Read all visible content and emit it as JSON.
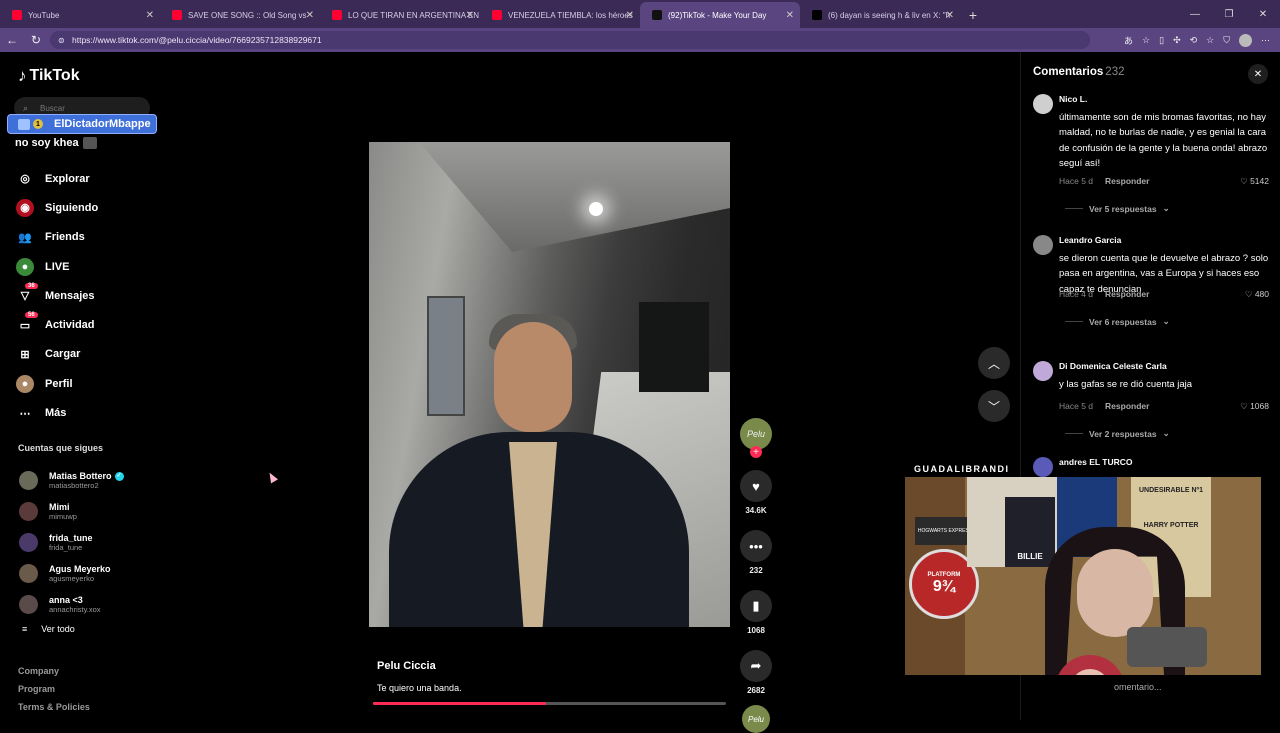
{
  "browser": {
    "tabs": [
      {
        "title": "YouTube",
        "favicon_color": "#ff0033",
        "active": false
      },
      {
        "title": "SAVE ONE SONG :: Old Song vs",
        "favicon_color": "#ff0033",
        "active": false
      },
      {
        "title": "LO QUE TIRAN EN ARGENTINA EN",
        "favicon_color": "#ff0033",
        "active": false
      },
      {
        "title": "VENEZUELA TIEMBLA: los héroes",
        "favicon_color": "#ff0033",
        "active": false
      },
      {
        "title": "(92)TikTok - Make Your Day",
        "favicon_color": "#111111",
        "active": true
      },
      {
        "title": "(6) dayan is seeing h & liv en X: \"h",
        "favicon_color": "#000000",
        "active": false
      }
    ],
    "url": "https://www.tiktok.com/@pelu.ciccia/video/7669235712838929671"
  },
  "sidebar": {
    "logo": "TikTok",
    "search_placeholder": "Buscar",
    "overlay_name": "ElDictadorMbappe",
    "overlay_badge": "1",
    "overlay_sub": "no soy khea",
    "menu": [
      {
        "label": "Explorar",
        "icon": "compass-icon",
        "glyph": "◎",
        "badge": ""
      },
      {
        "label": "Siguiendo",
        "icon": "following-icon",
        "glyph": "◉",
        "badge": ""
      },
      {
        "label": "Friends",
        "icon": "friends-icon",
        "glyph": "👥",
        "badge": ""
      },
      {
        "label": "LIVE",
        "icon": "live-icon",
        "glyph": "●",
        "badge": ""
      },
      {
        "label": "Mensajes",
        "icon": "messages-icon",
        "glyph": "▽",
        "badge": "36"
      },
      {
        "label": "Actividad",
        "icon": "activity-icon",
        "glyph": "▭",
        "badge": "56"
      },
      {
        "label": "Cargar",
        "icon": "upload-icon",
        "glyph": "⊞",
        "badge": ""
      },
      {
        "label": "Perfil",
        "icon": "profile-icon",
        "glyph": "●",
        "badge": ""
      },
      {
        "label": "Más",
        "icon": "more-icon",
        "glyph": "⋯",
        "badge": ""
      }
    ],
    "following_title": "Cuentas que sigues",
    "following": [
      {
        "name": "Matias Bottero",
        "handle": "matiasbottero2",
        "verified": true,
        "color": "#6a6a5a"
      },
      {
        "name": "Mimi",
        "handle": "mimuwp",
        "verified": false,
        "color": "#5a3a3a"
      },
      {
        "name": "frida_tune",
        "handle": "frida_tune",
        "verified": false,
        "color": "#4a3a6a"
      },
      {
        "name": "Agus Meyerko",
        "handle": "agusmeyerko",
        "verified": false,
        "color": "#6a5a4a"
      },
      {
        "name": "anna <3",
        "handle": "annachristy.xox",
        "verified": false,
        "color": "#5a4a4a"
      }
    ],
    "see_all": "Ver todo",
    "footer": [
      "Company",
      "Program",
      "Terms & Policies"
    ]
  },
  "video": {
    "author": "Pelu Ciccia",
    "description": "Te quiero una banda.",
    "progress": 0.49,
    "avatar_text": "Pelu"
  },
  "actions": {
    "likes": "34.6K",
    "comments": "232",
    "saves": "1068",
    "shares": "2682"
  },
  "comments": {
    "title": "Comentarios",
    "count": "232",
    "reply_label": "Responder",
    "items": [
      {
        "name": "Nico L.",
        "text": "últimamente son de mis bromas favoritas, no hay maldad, no te burlas de nadie, y es genial la cara de confusión de la gente y la buena onda! abrazo seguí así!",
        "time": "Hace 5 d",
        "likes": "5142",
        "replies": "Ver 5 respuestas",
        "color": "#cfcfcf"
      },
      {
        "name": "Leandro Garcia",
        "text": "se dieron cuenta que le devuelve el abrazo ? solo pasa en argentina, vas a Europa y si haces eso capaz te denuncian",
        "time": "Hace 4 d",
        "likes": "480",
        "replies": "Ver 6 respuestas",
        "color": "#888888"
      },
      {
        "name": "Di Domenica Celeste Carla",
        "text": "y las gafas se re dió cuenta jaja",
        "time": "Hace 5 d",
        "likes": "1068",
        "replies": "Ver 2 respuestas",
        "color": "#c0a8d8"
      },
      {
        "name": "andres EL TURCO",
        "text": "",
        "time": "",
        "likes": "",
        "replies": "",
        "color": "#5a5ab8"
      }
    ],
    "add_placeholder": "omentario..."
  },
  "stream": {
    "label": "GUADALIBRANDI",
    "posters": [
      "HOGWARTS EXPRESS",
      "BILLIE",
      "UNDESIRABLE Nº1",
      "HARRY POTTER",
      "PLATFORM",
      "9¾"
    ]
  }
}
